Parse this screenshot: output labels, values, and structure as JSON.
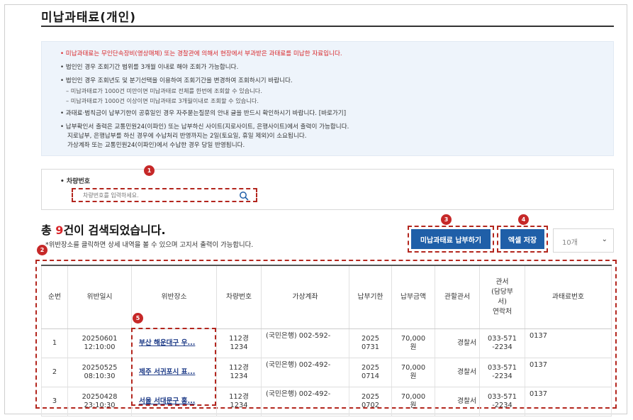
{
  "page_title": "미납과태료(개인)",
  "notices": [
    "• 미납과태료는 무인단속장비(영상매체) 또는 경찰관에 의해서 현장에서 부과받은 과태료를 미납한 자료입니다.",
    "• 법인인 경우 조회기간 범위를 3개월 이내로 해야 조회가 가능합니다.",
    "• 법인인 경우 조회년도 및 분기선택을 이용하여 조회기간을 변경하여 조회하시기 바랍니다.",
    "– 미납과태료가 1000건 미만이면 미납과태료 전체를 한번에 조회할 수 있습니다.",
    "– 미납과태료가 1000건 이상이면 미납과태료 3개월이내로 조회할 수 있습니다.",
    "• 과태료·범칙금이 납부기한이 공휴일인 경우 자주묻는질문의 안내 글을 반드시 확인하시기 바랍니다. [바로가기]",
    "• 납부확인서 출력은 교통민원24(이파인) 또는 납부하신 사이트(지로사이트, 은행사이트)에서 출력이 가능합니다.",
    "지로납부, 은행납부를 하신 경우에 수납처리 반영까지는 2일(토요일, 휴일 제외)이 소요됩니다.",
    "가상계좌 또는 교통민원24(이파인)에서 수납한 경우 당일 반영됩니다."
  ],
  "search": {
    "label": "• 차량번호",
    "placeholder": "차량번호를 입력하세요."
  },
  "results": {
    "prefix": "총 ",
    "count": "9",
    "suffix": "건이 검색되었습니다.",
    "hint": "*위반장소를 클릭하면 상세 내역을 볼 수 있으며 고지서 출력이 가능합니다."
  },
  "buttons": {
    "pay": "미납과태료 납부하기",
    "excel": "엑셀 저장"
  },
  "page_size": {
    "selected": "10개"
  },
  "badges": [
    "1",
    "2",
    "3",
    "4",
    "5"
  ],
  "table": {
    "headers": [
      "순번",
      "위반일시",
      "위반장소",
      "차량번호",
      "가상계좌",
      "납부기한",
      "납부금액",
      "관할관서",
      "관서\n(담당부\n서)\n연락처",
      "과태료번호"
    ],
    "rows": [
      {
        "no": "1",
        "datetime": "20250601\n12:10:00",
        "location": "부산 해운대구 우...",
        "plate": "112경\n1234",
        "account": "(국민은행) 002-592-",
        "due": "2025\n0731",
        "amount": "70,000\n원",
        "office": "경찰서",
        "phone": "033-571\n-2234",
        "fine_no": "0137"
      },
      {
        "no": "2",
        "datetime": "20250525\n08:10:30",
        "location": "제주 서귀포시 표...",
        "plate": "112경\n1234",
        "account": "(국민은행) 002-492-",
        "due": "2025\n0714",
        "amount": "70,000\n원",
        "office": "경찰서",
        "phone": "033-571\n-2234",
        "fine_no": "0137"
      },
      {
        "no": "3",
        "datetime": "20250428\n23:10:30",
        "location": "서울 서대문구 홍...",
        "plate": "112경\n1234",
        "account": "(국민은행) 002-492-",
        "due": "2025\n0702",
        "amount": "70,000\n원",
        "office": "경찰서",
        "phone": "033-571\n-2234",
        "fine_no": "0137"
      }
    ]
  },
  "colors": {
    "accent_blue": "#1f5fa8",
    "highlight_red": "#b3261e",
    "notice_red": "#d8262a",
    "notice_bg": "#eef4fb"
  }
}
